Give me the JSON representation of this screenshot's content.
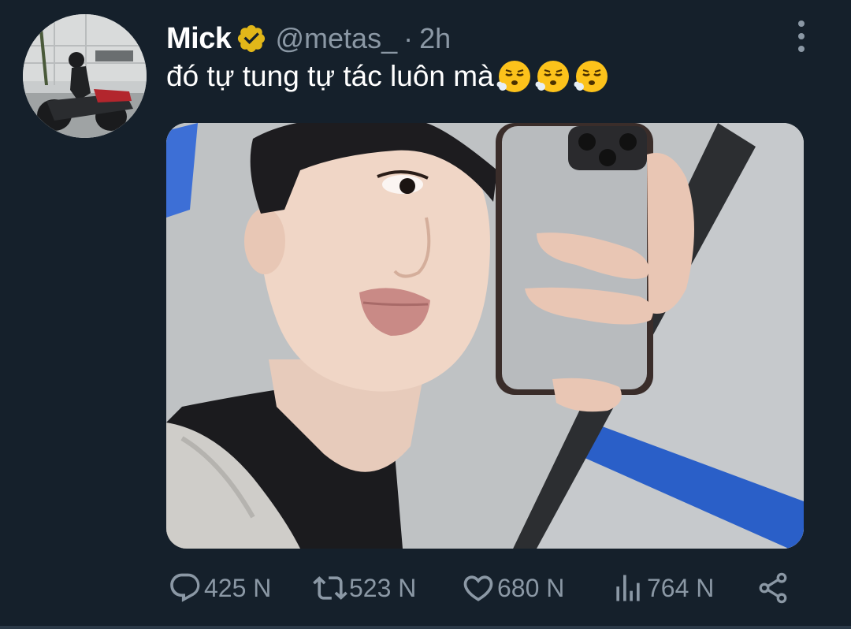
{
  "author": {
    "display_name": "Mick",
    "handle": "@metas_",
    "separator": "·",
    "time": "2h",
    "verified": true
  },
  "tweet": {
    "text": "đó tự tung tự tác luôn mà",
    "emojis": [
      "face-exhaling-emoji",
      "face-exhaling-emoji",
      "face-exhaling-emoji"
    ]
  },
  "actions": {
    "replies": "425 N",
    "retweets": "523 N",
    "likes": "680 N",
    "views": "764 N"
  },
  "icons": {
    "reply": "reply-icon",
    "retweet": "retweet-icon",
    "like": "heart-icon",
    "views": "views-icon",
    "share": "share-icon",
    "more": "more-vertical-icon",
    "verified": "verified-badge-icon"
  },
  "colors": {
    "background": "#15202b",
    "secondary_text": "#8b98a5",
    "verified_gold": "#e2b719"
  }
}
